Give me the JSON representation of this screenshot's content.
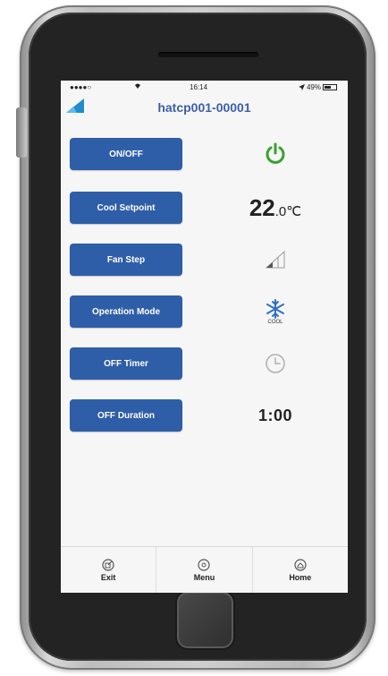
{
  "status_bar": {
    "signal": "●●●●○",
    "time": "16:14",
    "battery": "49%"
  },
  "header": {
    "title": "hatcp001-00001"
  },
  "controls": [
    {
      "label": "ON/OFF",
      "value_icon": "power-icon",
      "value_color": "#3aa12f"
    },
    {
      "label": "Cool Setpoint",
      "value_whole": "22",
      "value_dec": ".0",
      "unit": "℃"
    },
    {
      "label": "Fan Step",
      "value_icon": "fan-level-icon"
    },
    {
      "label": "Operation Mode",
      "value_icon": "snowflake-icon",
      "mode_text": "COOL"
    },
    {
      "label": "OFF Timer",
      "value_icon": "clock-icon"
    },
    {
      "label": "OFF Duration",
      "value_text": "1:00"
    }
  ],
  "nav": {
    "exit": "Exit",
    "menu": "Menu",
    "home": "Home"
  },
  "colors": {
    "accent": "#2f5ea8",
    "power_on": "#3aa12f",
    "title": "#3d5fa8"
  }
}
